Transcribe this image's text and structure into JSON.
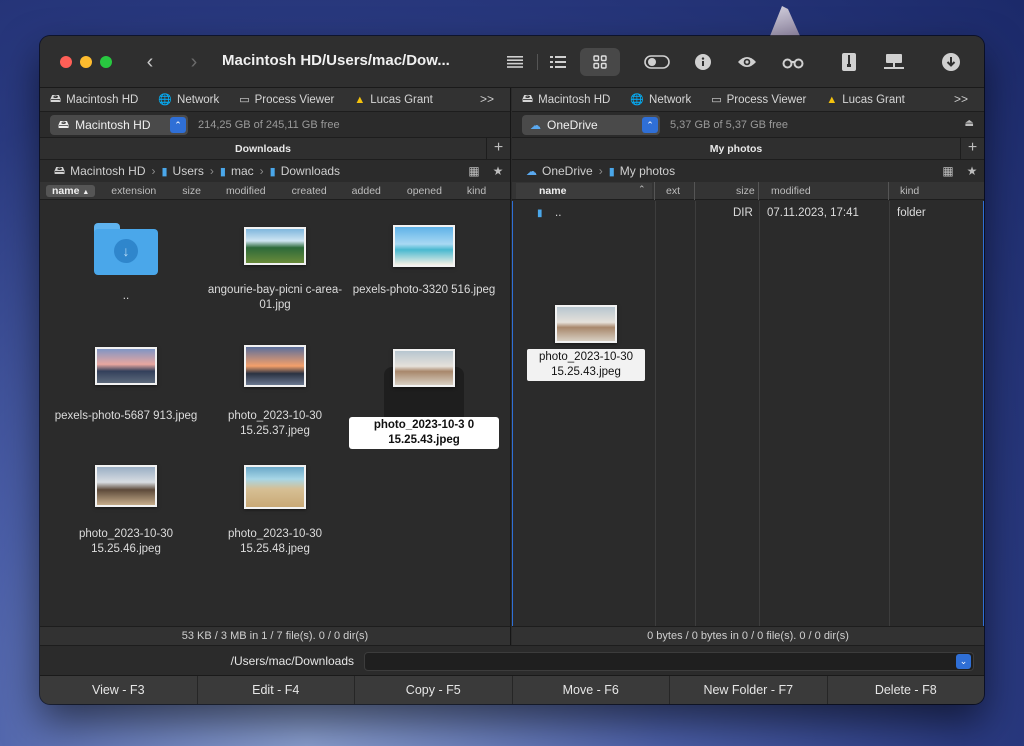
{
  "window": {
    "title": "Macintosh HD/Users/mac/Dow...",
    "toolbar_icons": [
      "list-icon",
      "detail-list-icon",
      "grid-icon",
      "toggle-icon",
      "info-icon",
      "eye-icon",
      "binoculars-icon",
      "archive-icon",
      "network-drive-icon",
      "download-icon"
    ]
  },
  "tabs": [
    {
      "label": "Macintosh HD",
      "icon": "drive-icon"
    },
    {
      "label": "Network",
      "icon": "globe-icon"
    },
    {
      "label": "Process Viewer",
      "icon": "monitor-icon"
    },
    {
      "label": "Lucas Grant",
      "icon": "google-drive-icon"
    }
  ],
  "tabs_more": ">>",
  "left": {
    "drive": "Macintosh HD",
    "free": "214,25 GB of 245,11 GB free",
    "pane_title": "Downloads",
    "breadcrumb": [
      "Macintosh HD",
      "Users",
      "mac",
      "Downloads"
    ],
    "columns": [
      "name",
      "extension",
      "size",
      "modified",
      "created",
      "added",
      "opened",
      "kind"
    ],
    "sort_indicator": "▲",
    "items": [
      {
        "label": "..",
        "kind": "folder"
      },
      {
        "label": "angourie-bay-picni c-area-01.jpg",
        "kind": "photo",
        "style": "bay"
      },
      {
        "label": "pexels-photo-3320 516.jpeg",
        "kind": "photo",
        "style": "beach"
      },
      {
        "label": "pexels-photo-5687 913.jpeg",
        "kind": "photo",
        "style": "dusk"
      },
      {
        "label": "photo_2023-10-30 15.25.37.jpeg",
        "kind": "photo",
        "style": "sunset"
      },
      {
        "label": "photo_2023-10-3 0 15.25.43.jpeg",
        "kind": "photo",
        "style": "rock",
        "selected": true
      },
      {
        "label": "photo_2023-10-30 15.25.46.jpeg",
        "kind": "photo",
        "style": "stack"
      },
      {
        "label": "photo_2023-10-30 15.25.48.jpeg",
        "kind": "photo",
        "style": "sand"
      }
    ],
    "status": "53 KB / 3 MB in 1 / 7 file(s). 0 / 0 dir(s)"
  },
  "right": {
    "drive": "OneDrive",
    "free": "5,37 GB of 5,37 GB free",
    "pane_title": "My photos",
    "breadcrumb": [
      "OneDrive",
      "My photos"
    ],
    "columns": {
      "name": "name",
      "ext": "ext",
      "size": "size",
      "modified": "modified",
      "kind": "kind"
    },
    "rows": [
      {
        "name": "..",
        "ext": "",
        "size": "DIR",
        "modified": "07.11.2023, 17:41",
        "kind": "folder"
      }
    ],
    "drag_item_label": "photo_2023-10-30 15.25.43.jpeg",
    "status": "0 bytes / 0 bytes in 0 / 0 file(s). 0 / 0 dir(s)"
  },
  "command": {
    "path": "/Users/mac/Downloads",
    "value": ""
  },
  "fkeys": [
    "View - F3",
    "Edit - F4",
    "Copy - F5",
    "Move - F6",
    "New Folder - F7",
    "Delete - F8"
  ],
  "colors": {
    "accent": "#2f6fd6",
    "folder": "#4aa7ea"
  }
}
